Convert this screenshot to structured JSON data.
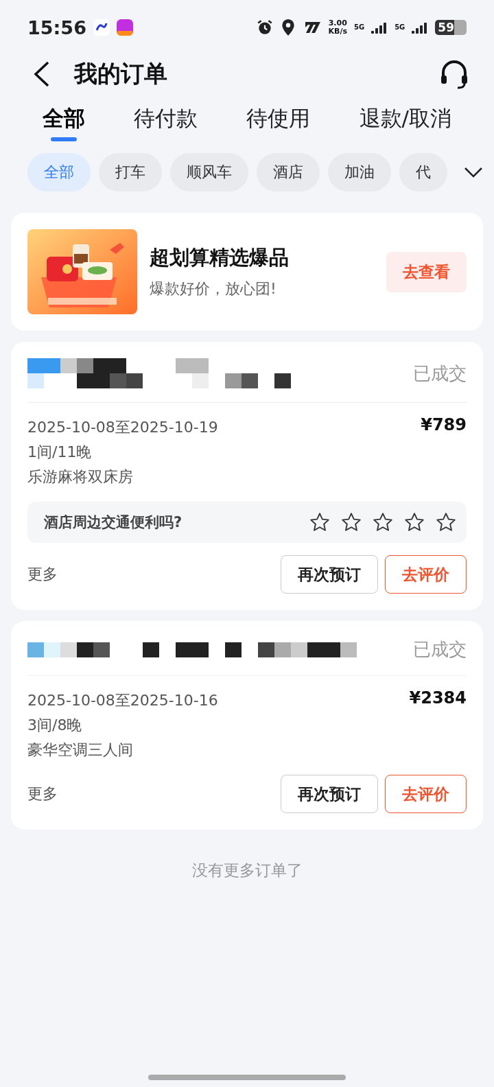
{
  "status_bar": {
    "time": "15:56",
    "speed": "3.00",
    "speed_unit": "KB/s",
    "network_1": "5G",
    "network_2": "5G",
    "battery": "59"
  },
  "header": {
    "title": "我的订单"
  },
  "tabs": [
    {
      "label": "全部",
      "selected": true
    },
    {
      "label": "待付款",
      "selected": false
    },
    {
      "label": "待使用",
      "selected": false
    },
    {
      "label": "退款/取消",
      "selected": false
    }
  ],
  "filters": [
    {
      "label": "全部",
      "selected": true
    },
    {
      "label": "打车",
      "selected": false
    },
    {
      "label": "顺风车",
      "selected": false
    },
    {
      "label": "酒店",
      "selected": false
    },
    {
      "label": "加油",
      "selected": false
    },
    {
      "label": "代",
      "selected": false
    }
  ],
  "promo": {
    "title": "超划算精选爆品",
    "subtitle": "爆款好价，放心团!",
    "button": "去查看"
  },
  "orders": [
    {
      "status": "已成交",
      "dates": "2025-10-08至2025-10-19",
      "price": "¥789",
      "nights": "1间/11晚",
      "room": "乐游麻将双床房",
      "rating": {
        "question": "酒店周边交通便利吗?",
        "stars": 0
      },
      "more": "更多",
      "buttons": [
        "再次预订",
        "去评价"
      ]
    },
    {
      "status": "已成交",
      "dates": "2025-10-08至2025-10-16",
      "price": "¥2384",
      "nights": "3间/8晚",
      "room": "豪华空调三人间",
      "more": "更多",
      "buttons": [
        "再次预订",
        "去评价"
      ]
    }
  ],
  "footer": "没有更多订单了"
}
